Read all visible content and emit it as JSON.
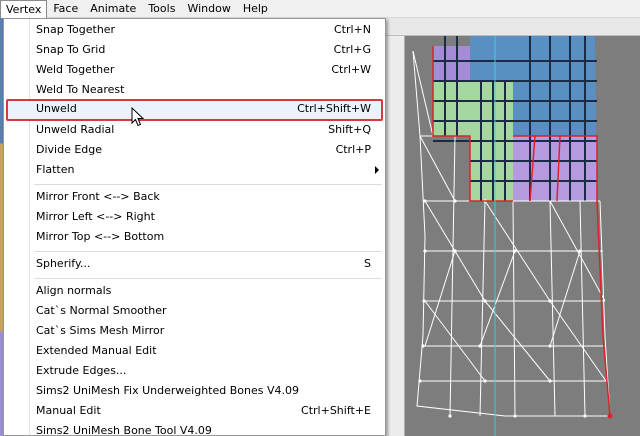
{
  "menubar": {
    "items": [
      "Vertex",
      "Face",
      "Animate",
      "Tools",
      "Window",
      "Help"
    ]
  },
  "vertex_menu": {
    "items": [
      {
        "label": "Snap Together",
        "shortcut": "Ctrl+N"
      },
      {
        "label": "Snap To Grid",
        "shortcut": "Ctrl+G"
      },
      {
        "label": "Weld Together",
        "shortcut": "Ctrl+W"
      },
      {
        "label": "Weld To Nearest",
        "shortcut": ""
      },
      {
        "label": "Unweld",
        "shortcut": "Ctrl+Shift+W"
      },
      {
        "label": "Unweld Radial",
        "shortcut": "Shift+Q"
      },
      {
        "label": "Divide Edge",
        "shortcut": "Ctrl+P"
      },
      {
        "label": "Flatten",
        "shortcut": ""
      },
      {
        "label": "Mirror Front <--> Back",
        "shortcut": ""
      },
      {
        "label": "Mirror Left <--> Right",
        "shortcut": ""
      },
      {
        "label": "Mirror Top <--> Bottom",
        "shortcut": ""
      },
      {
        "label": "Spherify...",
        "shortcut": "S"
      },
      {
        "label": "Align normals",
        "shortcut": ""
      },
      {
        "label": "Cat`s Normal Smoother",
        "shortcut": ""
      },
      {
        "label": "Cat`s Sims Mesh Mirror",
        "shortcut": ""
      },
      {
        "label": "Extended Manual Edit",
        "shortcut": ""
      },
      {
        "label": "Extrude Edges...",
        "shortcut": ""
      },
      {
        "label": "Sims2 UniMesh Fix Underweighted Bones V4.09",
        "shortcut": ""
      },
      {
        "label": "Manual Edit",
        "shortcut": "Ctrl+Shift+E"
      },
      {
        "label": "Sims2 UniMesh Bone Tool V4.09",
        "shortcut": ""
      }
    ],
    "highlighted": "Unweld",
    "submenu_item": "Flatten"
  },
  "colors": {
    "highlight_border": "#d8393e",
    "highlight_fill": "#eaf3fc",
    "menu_bg": "#ffffff",
    "viewport_bg": "#7d7d7d",
    "mesh_wire": "#ffffff",
    "selected_edge": "#e0202a"
  },
  "icons": [
    "arrow-cursor-icon",
    "submenu-arrow-icon"
  ]
}
